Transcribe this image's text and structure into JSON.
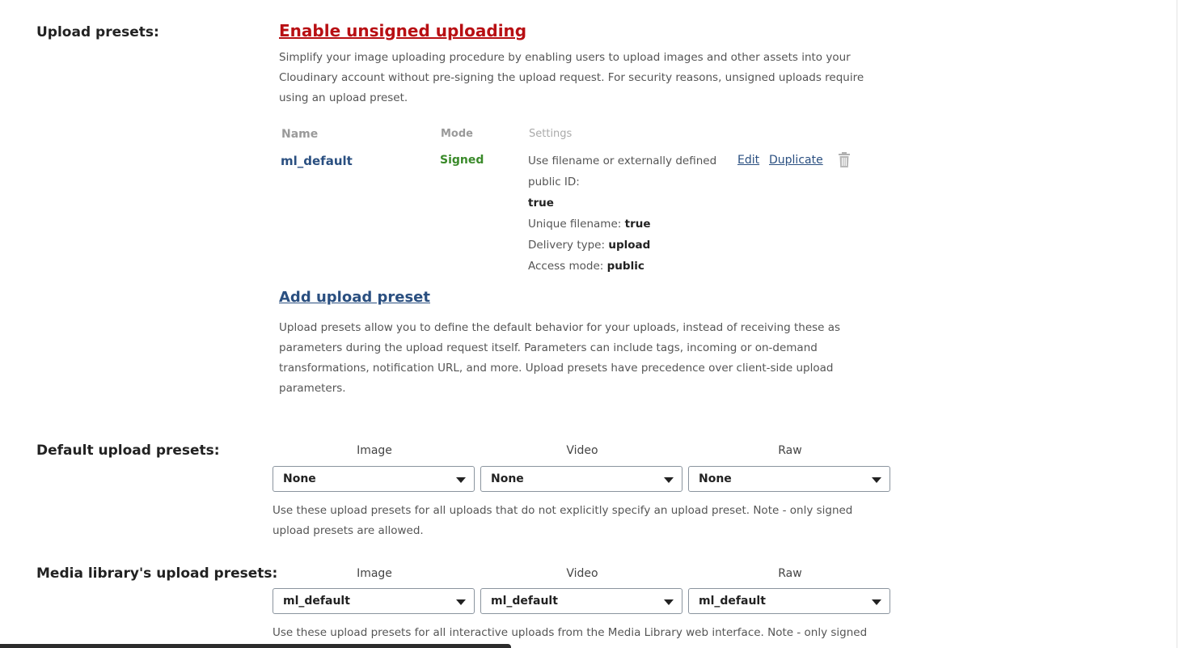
{
  "upload_presets": {
    "label": "Upload presets:",
    "enable_link": "Enable unsigned uploading",
    "enable_desc": [
      "Simplify your image uploading procedure by enabling users to upload images and other assets into your",
      "Cloudinary account without pre-signing the upload request. For security reasons, unsigned uploads require",
      "using an upload preset."
    ],
    "table": {
      "headers": {
        "name": "Name",
        "mode": "Mode",
        "settings": "Settings"
      },
      "rows": [
        {
          "name": "ml_default",
          "mode": "Signed",
          "settings": {
            "filename_label_1": "Use filename or externally defined",
            "filename_label_2": "public ID:",
            "filename_value": "true",
            "unique_label": "Unique filename:",
            "unique_value": "true",
            "delivery_label": "Delivery type:",
            "delivery_value": "upload",
            "access_label": "Access mode:",
            "access_value": "public"
          },
          "edit": "Edit",
          "duplicate": "Duplicate",
          "delete_icon": "trash-icon"
        }
      ]
    },
    "add_link": "Add upload preset",
    "add_desc": [
      "Upload presets allow you to define the default behavior for your uploads, instead of receiving these as",
      "parameters during the upload request itself. Parameters can include tags, incoming or on-demand",
      "transformations, notification URL, and more. Upload presets have precedence over client-side upload",
      "parameters."
    ]
  },
  "default_presets": {
    "label": "Default upload presets:",
    "columns": [
      "Image",
      "Video",
      "Raw"
    ],
    "values": [
      "None",
      "None",
      "None"
    ],
    "note": [
      "Use these upload presets for all uploads that do not explicitly specify an upload preset. Note - only signed",
      "upload presets are allowed."
    ]
  },
  "media_library_presets": {
    "label": "Media library's upload presets:",
    "columns": [
      "Image",
      "Video",
      "Raw"
    ],
    "values": [
      "ml_default",
      "ml_default",
      "ml_default"
    ],
    "note": [
      "Use these upload presets for all interactive uploads from the Media Library web interface. Note - only signed"
    ]
  },
  "colors": {
    "enable_link": "#b80f13",
    "link": "#2a4f80",
    "signed": "#3a8a2a"
  }
}
